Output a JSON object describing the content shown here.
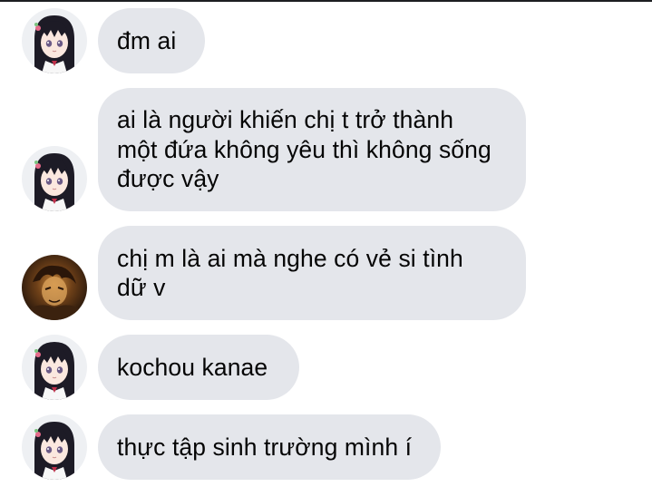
{
  "messages": [
    {
      "sender": "kanao-avatar",
      "text": "đm ai"
    },
    {
      "sender": "kanao-avatar",
      "text": "ai là người khiến chị t trở thành\nmột đứa không yêu thì không sống\nđược vậy"
    },
    {
      "sender": "dark-avatar",
      "text": "chị m là ai mà nghe có vẻ si tình\ndữ v"
    },
    {
      "sender": "kanao-avatar",
      "text": "kochou kanae"
    },
    {
      "sender": "kanao-avatar",
      "text": "thực tập sinh trường mình í"
    }
  ],
  "colors": {
    "bubble": "#e4e6eb",
    "text": "#050505",
    "background": "#ffffff"
  }
}
